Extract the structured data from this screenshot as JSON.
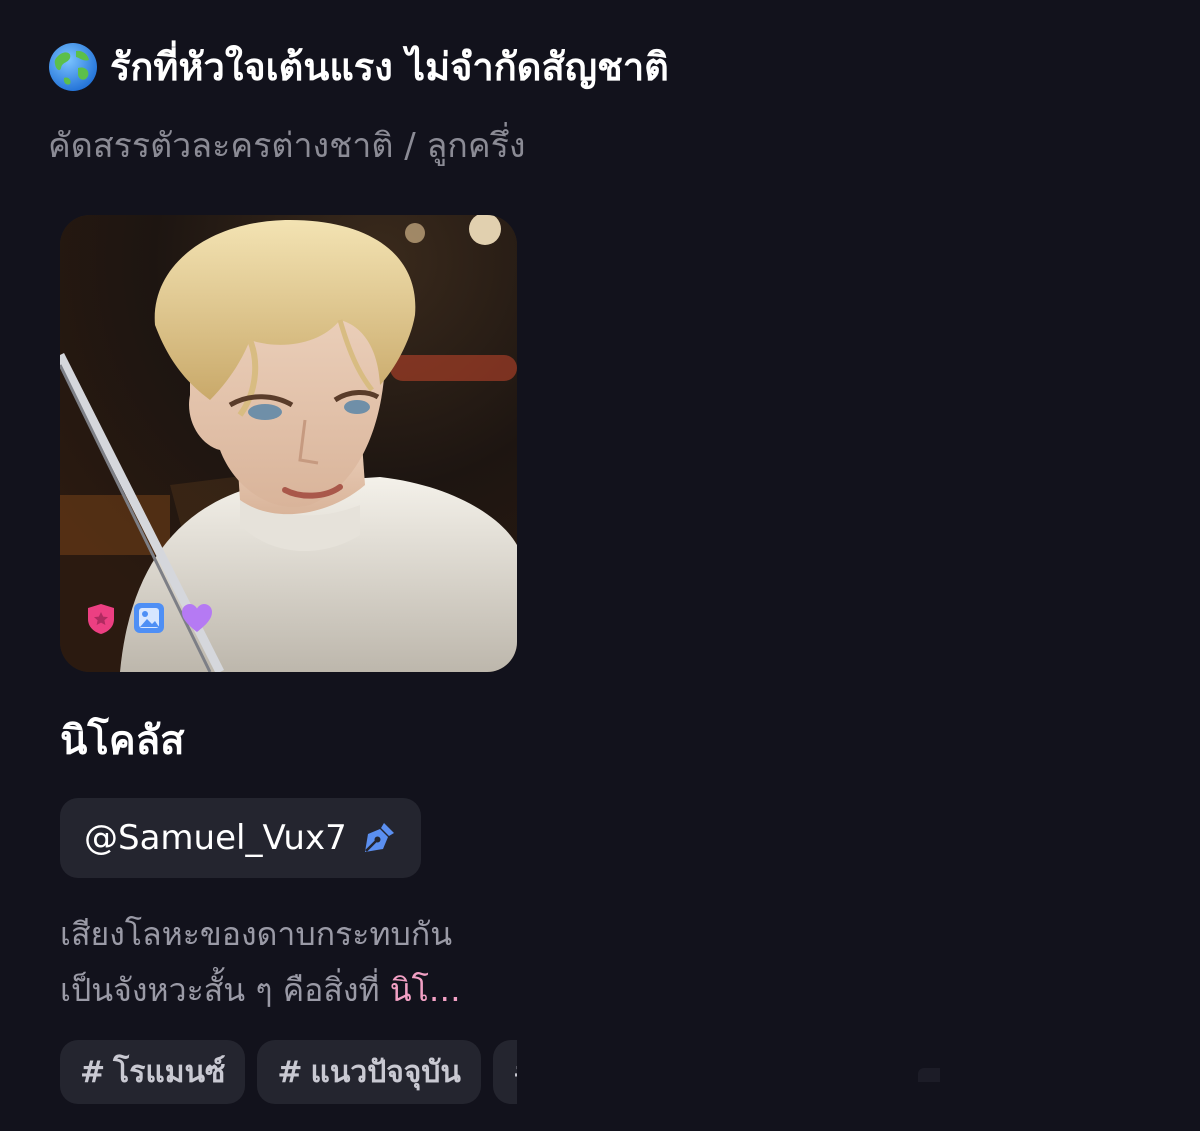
{
  "section": {
    "icon": "globe-icon",
    "title": "รักที่หัวใจเต้นแรง ไม่จำกัดสัญชาติ",
    "subtitle": "คัดสรรตัวละครต่างชาติ / ลูกครึ่ง"
  },
  "card": {
    "name": "นิโคลัส",
    "creator": "@Samuel_Vux7",
    "description_line1": "เสียงโลหะของดาบกระทบกัน",
    "description_line2_prefix": "เป็นจังหวะสั้น ๆ คือสิ่งที่ ",
    "description_line2_highlight": "นิโ…",
    "badges": [
      "shield-star-icon",
      "image-icon",
      "heart-icon"
    ],
    "tags": [
      "โรแมนซ์",
      "แนวปัจจุบัน",
      ""
    ],
    "tag_prefix": "#"
  },
  "colors": {
    "background": "#12121c",
    "chip": "#24252f",
    "subtitle": "#8b8b95",
    "description": "#9a9aa6",
    "highlight": "#f2a0c4",
    "pen_icon": "#5b8ff0",
    "badge_shield": "#ec3f82",
    "badge_image": "#4e8ff5",
    "badge_heart": "#b57af3"
  }
}
